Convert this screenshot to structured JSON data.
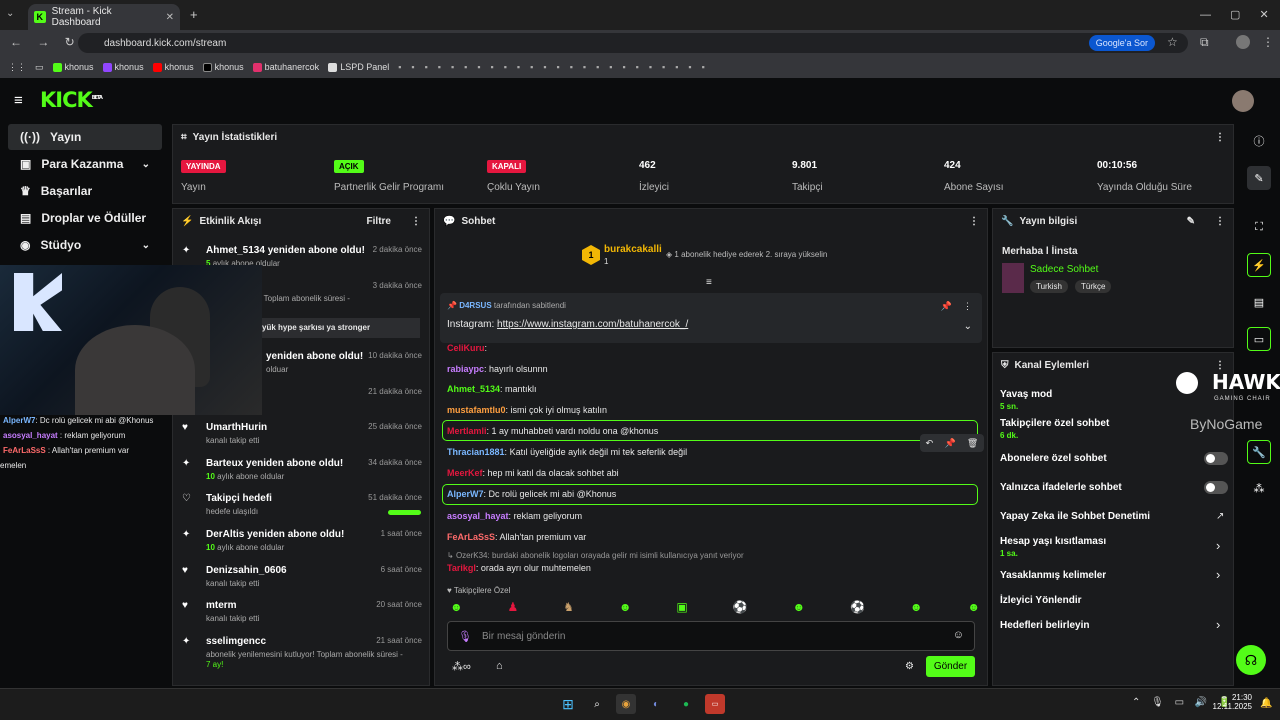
{
  "browser": {
    "tab_title": "Stream - Kick Dashboard",
    "url": "dashboard.kick.com/stream",
    "google_btn": "Google'a Sor"
  },
  "bookmarks": [
    "khonus",
    "khonus",
    "khonus",
    "khonus",
    "batuhanercok",
    "LSPD Panel"
  ],
  "brand": {
    "logo": "KICK",
    "beta": "BETA",
    "accent": "#53fc18"
  },
  "sidebar": {
    "items": [
      {
        "label": "Yayın",
        "icon": "broadcast-icon"
      },
      {
        "label": "Para Kazanma",
        "icon": "money-icon"
      },
      {
        "label": "Başarılar",
        "icon": "trophy-icon"
      },
      {
        "label": "Droplar ve Ödüller",
        "icon": "gift-icon"
      },
      {
        "label": "Stüdyo",
        "icon": "studio-icon"
      }
    ]
  },
  "stats": {
    "title": "Yayın İstatistikleri",
    "items": [
      {
        "badge": "YAYINDA",
        "label": "Yayın",
        "color": "#e5173f"
      },
      {
        "badge": "AÇIK",
        "label": "Partnerlik Gelir Programı",
        "color": "#53fc18"
      },
      {
        "badge": "KAPALI",
        "label": "Çoklu Yayın",
        "color": "#e5173f"
      },
      {
        "value": "462",
        "label": "İzleyici"
      },
      {
        "value": "9.801",
        "label": "Takipçi"
      },
      {
        "value": "424",
        "label": "Abone Sayısı"
      },
      {
        "value": "00:10:56",
        "label": "Yayında Olduğu Süre"
      }
    ]
  },
  "activity": {
    "title": "Etkinlik Akışı",
    "filter": "Filtre",
    "events": [
      {
        "title": "Ahmet_5134 yeniden abone oldu!",
        "sub_num": "5",
        "sub": "aylık abone oldular",
        "time": "2 dakika önce",
        "icon": "sparkle-icon"
      },
      {
        "title": "",
        "sub": "mesini kutluyor! Toplam abonelik süresi -",
        "time": "3 dakika önce",
        "icon": "sparkle-icon"
      },
      {
        "title": "yük hype şarkısı ya stronger",
        "sub": "",
        "time": "",
        "icon": "sparkle-icon"
      },
      {
        "title": "yeniden abone oldu!",
        "sub": "olduar",
        "time": "10 dakika önce",
        "icon": "sparkle-icon"
      },
      {
        "title": "",
        "sub": "",
        "time": "21 dakika önce",
        "icon": "sparkle-icon"
      },
      {
        "title": "UmarthHurin",
        "sub": "kanalı takip etti",
        "time": "25 dakika önce",
        "icon": "heart-icon"
      },
      {
        "title": "Barteux yeniden abone oldu!",
        "sub_num": "10",
        "sub": "aylık abone oldular",
        "time": "34 dakika önce",
        "icon": "sparkle-icon"
      },
      {
        "title": "Takipçi hedefi",
        "sub": "hedefe ulaşıldı",
        "time": "51 dakika önce",
        "icon": "heart-outline-icon"
      },
      {
        "title": "DerAltis yeniden abone oldu!",
        "sub_num": "10",
        "sub": "aylık abone oldular",
        "time": "1 saat önce",
        "icon": "sparkle-icon"
      },
      {
        "title": "Denizsahin_0606",
        "sub": "kanalı takip etti",
        "time": "6 saat önce",
        "icon": "heart-icon"
      },
      {
        "title": "mterm",
        "sub": "kanalı takip etti",
        "time": "20 saat önce",
        "icon": "heart-icon"
      },
      {
        "title": "sselimgencc",
        "sub": "abonelik yenilemesini kutluyor! Toplam abonelik süresi -",
        "sub2": "7 ay!",
        "time": "21 saat önce",
        "icon": "sparkle-icon"
      }
    ]
  },
  "chat": {
    "title": "Sohbet",
    "top_user": "burakcakalli",
    "top_count": "1",
    "gift_hint": "1 abonelik hediye ederek 2. sıraya yükselin",
    "pinned_by": "D4RSUS",
    "pinned_text": "tarafından sabitlendi",
    "pinned_label": "Instagram:",
    "pinned_link": "https://www.instagram.com/batuhanercok_/",
    "messages": [
      {
        "user": "CeliKuru",
        "text": "",
        "color": "#e5173f"
      },
      {
        "user": "rabiaypc",
        "text": "hayırlı olsunnn",
        "color": "#c77dff"
      },
      {
        "user": "Ahmet_5134",
        "text": "mantıklı",
        "color": "#53fc18"
      },
      {
        "user": "mustafamtlu0",
        "text": "ismi çok iyi olmuş katılın",
        "color": "#ff9f40"
      },
      {
        "user": "Mertlamli",
        "text": "1 ay muhabbeti vardı noldu ona @khonus",
        "color": "#e5173f"
      },
      {
        "user": "Thracian1881",
        "text": "Katıl üyeliğide aylık değil mi tek seferlik değil",
        "color": "#7ab7ff"
      },
      {
        "user": "MeerKef",
        "text": "hep mi katıl da olacak sohbet abi",
        "color": "#e5173f"
      },
      {
        "user": "AlperW7",
        "text": "Dc rolü gelicek mi abi @Khonus",
        "color": "#7ab7ff"
      },
      {
        "user": "asosyal_hayat",
        "text": "reklam geliyorum",
        "color": "#c77dff"
      },
      {
        "user": "FeArLaSsS",
        "text": "Allah'tan premium var",
        "color": "#ff6b6b"
      },
      {
        "user": "Tarikgl",
        "text": "orada ayrı olur muhtemelen",
        "color": "#e5173f"
      }
    ],
    "reply_hint": "OzerK34: burdaki abonelik logoları orayada gelir mi isimli kullanıcıya yanıt veriyor",
    "emote_label": "Takipçilere Özel",
    "input_placeholder": "Bir mesaj gönderin",
    "send": "Gönder"
  },
  "info": {
    "title": "Yayın bilgisi",
    "stream_title": "Merhaba l İinsta",
    "category": "Sadece Sohbet",
    "tags": [
      "Turkish",
      "Türkçe"
    ]
  },
  "actions": {
    "title": "Kanal Eylemleri",
    "items": [
      {
        "label": "Yavaş mod",
        "sub": "5 sn."
      },
      {
        "label": "Takipçilere özel sohbet",
        "sub": "6 dk."
      },
      {
        "label": "Abonelere özel sohbet",
        "sub": ""
      },
      {
        "label": "Yalnızca ifadelerle sohbet",
        "sub": ""
      },
      {
        "label": "Yapay Zeka ile Sohbet Denetimi",
        "sub": ""
      },
      {
        "label": "Hesap yaşı kısıtlaması",
        "sub": "1 sa."
      },
      {
        "label": "Yasaklanmış kelimeler",
        "sub": ""
      },
      {
        "label": "İzleyici Yönlendir",
        "sub": ""
      },
      {
        "label": "Hedefleri belirleyin",
        "sub": ""
      }
    ]
  },
  "overlay": {
    "brand": "HAWK",
    "brand_sub": "GAMING CHAIR",
    "brand2": "ByNoGame",
    "chat": [
      {
        "user": "AlperW7",
        "text": ": Dc rolü gelicek mi abi @Khonus",
        "color": "#7ab7ff"
      },
      {
        "user": "asosyal_hayat",
        "text": " : reklam geliyorum",
        "color": "#c77dff"
      },
      {
        "user": "FeArLaSsS",
        "text": " : Allah'tan premium var",
        "color": "#ff6b6b"
      },
      {
        "user": "emelen",
        "text": "",
        "color": "#ddd"
      }
    ]
  },
  "taskbar": {
    "time": "21:30",
    "date": "12.11.2025"
  }
}
